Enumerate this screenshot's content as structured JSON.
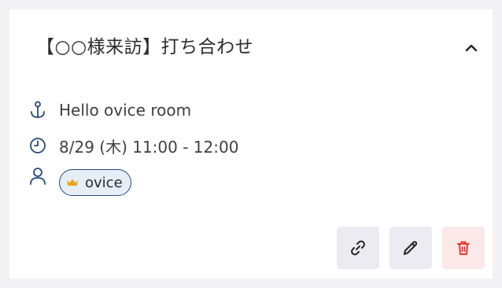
{
  "event": {
    "title": "【○○様来訪】打ち合わせ",
    "place": "Hello ovice room",
    "datetime": "8/29 (木) 11:00 - 12:00",
    "attendees": [
      {
        "name": "ovice",
        "role_icon": "crown-icon"
      }
    ]
  },
  "colors": {
    "icon_blue": "#274a78",
    "crown_gold": "#e8a317",
    "delete_red": "#e53935"
  },
  "icons": {
    "collapse": "chevron-up-icon",
    "place": "anchor-icon",
    "time": "clock-icon",
    "people": "person-icon",
    "copy_link": "link-icon",
    "edit": "pencil-icon",
    "delete": "trash-icon"
  }
}
